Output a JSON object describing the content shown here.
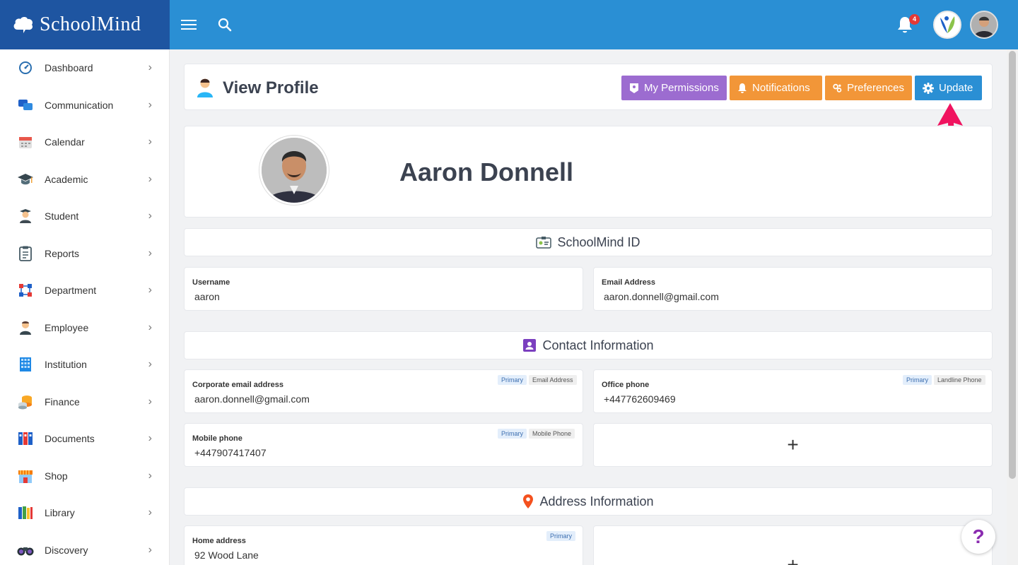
{
  "app": {
    "brand": "SchoolMind"
  },
  "topbar": {
    "notification_count": "4"
  },
  "sidebar": {
    "items": [
      {
        "label": "Dashboard",
        "icon": "gauge-icon"
      },
      {
        "label": "Communication",
        "icon": "chat-icon"
      },
      {
        "label": "Calendar",
        "icon": "calendar-icon"
      },
      {
        "label": "Academic",
        "icon": "graduation-cap-icon"
      },
      {
        "label": "Student",
        "icon": "student-icon"
      },
      {
        "label": "Reports",
        "icon": "clipboard-icon"
      },
      {
        "label": "Department",
        "icon": "org-chart-icon"
      },
      {
        "label": "Employee",
        "icon": "employee-icon"
      },
      {
        "label": "Institution",
        "icon": "building-icon"
      },
      {
        "label": "Finance",
        "icon": "coins-icon"
      },
      {
        "label": "Documents",
        "icon": "binders-icon"
      },
      {
        "label": "Shop",
        "icon": "shop-icon"
      },
      {
        "label": "Library",
        "icon": "books-icon"
      },
      {
        "label": "Discovery",
        "icon": "binoculars-icon"
      }
    ]
  },
  "header": {
    "title": "View Profile",
    "buttons": {
      "permissions": "My Permissions",
      "notifications": "Notifications",
      "preferences": "Preferences",
      "update": "Update"
    }
  },
  "profile": {
    "name": "Aaron Donnell"
  },
  "schoolmind_id": {
    "title": "SchoolMind ID",
    "username_label": "Username",
    "username": "aaron",
    "email_label": "Email Address",
    "email": "aaron.donnell@gmail.com"
  },
  "contact": {
    "title": "Contact Information",
    "corporate_email": {
      "label": "Corporate email address",
      "value": "aaron.donnell@gmail.com",
      "tag": "Primary",
      "kind": "Email Address"
    },
    "office_phone": {
      "label": "Office phone",
      "value": "+447762609469",
      "tag": "Primary",
      "kind": "Landline Phone"
    },
    "mobile_phone": {
      "label": "Mobile phone",
      "value": "+447907417407",
      "tag": "Primary",
      "kind": "Mobile Phone"
    },
    "add": "+"
  },
  "address": {
    "title": "Address Information",
    "home": {
      "label": "Home address",
      "value": "92 Wood Lane",
      "tag": "Primary"
    },
    "add": "+"
  },
  "help": "?",
  "colors": {
    "brand_dark": "#1e55a1",
    "topbar": "#2a8fd4",
    "permissions": "#9c6cd0",
    "orange": "#f29638",
    "annotation_arrow": "#f0135f"
  }
}
